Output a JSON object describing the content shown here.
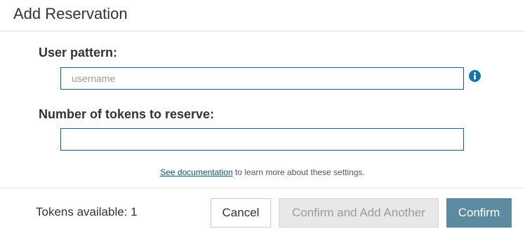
{
  "dialog": {
    "title": "Add Reservation"
  },
  "form": {
    "user_pattern_label": "User pattern:",
    "user_pattern_value": "",
    "user_pattern_placeholder": "username",
    "tokens_label": "Number of tokens to reserve:",
    "tokens_value": "",
    "tokens_placeholder": ""
  },
  "help": {
    "link_text": "See documentation",
    "rest_text": " to learn more about these settings."
  },
  "footer": {
    "tokens_available": "Tokens available: 1",
    "cancel_label": "Cancel",
    "confirm_add_label": "Confirm and Add Another",
    "confirm_label": "Confirm"
  },
  "icons": {
    "info": "info-icon"
  },
  "colors": {
    "input_border": "#1a5c7a",
    "info_icon": "#1577a8",
    "link": "#0f4d73",
    "primary_button": "#5b8aa1",
    "disabled_button_bg": "#e8e8e8",
    "disabled_button_text": "#9b9b9b"
  }
}
